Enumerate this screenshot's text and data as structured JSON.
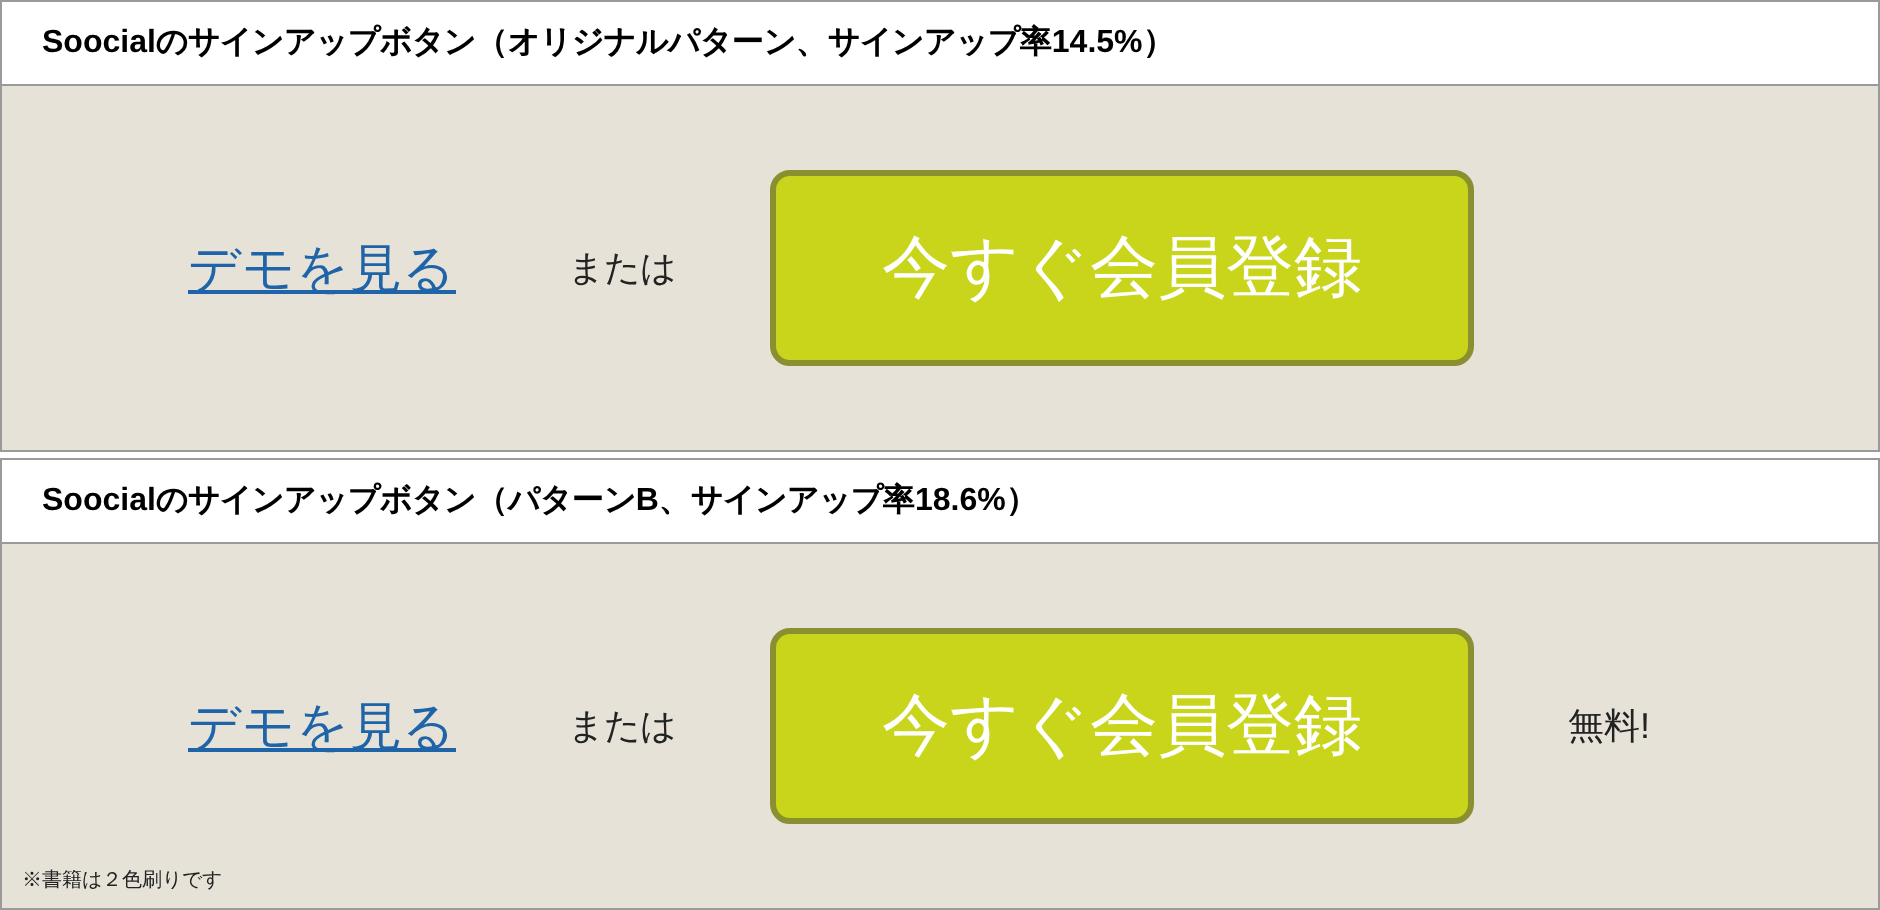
{
  "panels": [
    {
      "title": "Soocialのサインアップボタン（オリジナルパターン、サインアップ率14.5%）",
      "demo_link": "デモを見る",
      "or_text": "または",
      "signup_button": "今すぐ会員登録"
    },
    {
      "title": "Soocialのサインアップボタン（パターンB、サインアップ率18.6%）",
      "demo_link": "デモを見る",
      "or_text": "または",
      "signup_button": "今すぐ会員登録",
      "note": "無料!",
      "footnote": "※書籍は２色刷りです"
    }
  ]
}
